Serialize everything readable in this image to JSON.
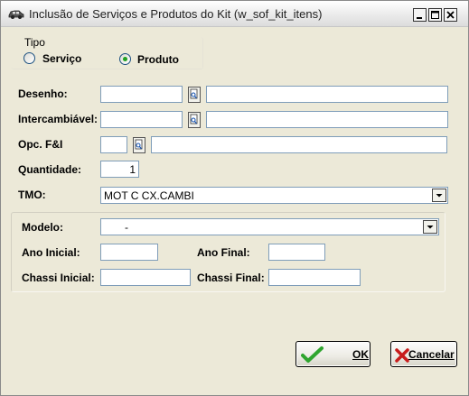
{
  "window": {
    "title": "Inclusão de Serviços e Produtos do Kit (w_sof_kit_itens)"
  },
  "tipo": {
    "label": "Tipo",
    "options": [
      {
        "label": "Serviço",
        "selected": false
      },
      {
        "label": "Produto",
        "selected": true
      }
    ]
  },
  "form": {
    "desenho": {
      "label": "Desenho:",
      "code": "",
      "description": ""
    },
    "intercambiavel": {
      "label": "Intercambiável:",
      "code": "",
      "description": ""
    },
    "opc_fi": {
      "label": "Opc. F&I",
      "code": "",
      "description": ""
    },
    "quantidade": {
      "label": "Quantidade:",
      "value": "1"
    },
    "tmo": {
      "label": "TMO:",
      "value": "MOT C CX.CAMBI"
    }
  },
  "veiculo": {
    "modelo": {
      "label": "Modelo:",
      "value": "-"
    },
    "ano_inicial": {
      "label": "Ano Inicial:",
      "value": ""
    },
    "ano_final": {
      "label": "Ano Final:",
      "value": ""
    },
    "chassi_inicial": {
      "label": "Chassi Inicial:",
      "value": ""
    },
    "chassi_final": {
      "label": "Chassi Final:",
      "value": ""
    }
  },
  "buttons": {
    "ok": "OK",
    "cancel": "Cancelar"
  },
  "colors": {
    "window_bg": "#ece9d8",
    "field_border": "#7f9db9",
    "ok_check": "#2fa52f",
    "cancel_x": "#c81c1c"
  },
  "icons": {
    "app": "car-icon",
    "lookup": "lookup-icon",
    "dropdown": "chevron-down-icon",
    "ok": "checkmark-icon",
    "cancel": "x-icon"
  }
}
